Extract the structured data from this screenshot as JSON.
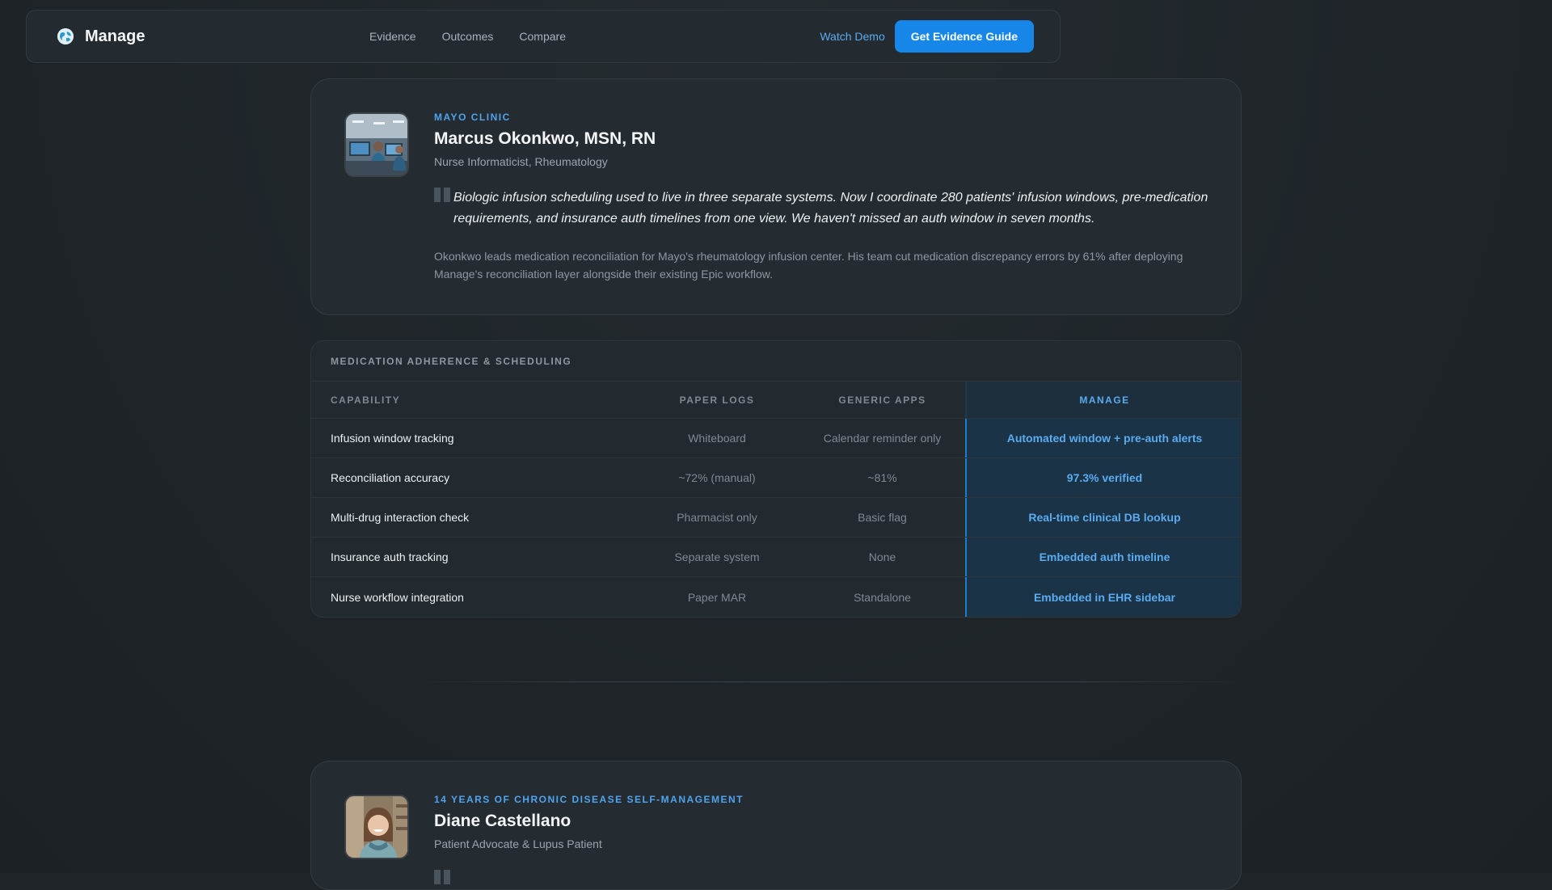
{
  "nav": {
    "brand": "Manage",
    "logo_icon": "globe-icon",
    "links": [
      "Evidence",
      "Outcomes",
      "Compare"
    ],
    "watch_demo": "Watch Demo",
    "cta": "Get Evidence Guide"
  },
  "testimonial_1": {
    "org": "MAYO CLINIC",
    "name": "Marcus Okonkwo, MSN, RN",
    "role": "Nurse Informaticist, Rheumatology",
    "quote": "Biologic infusion scheduling used to live in three separate systems. Now I coordinate 280 patients' infusion windows, pre-medication requirements, and insurance auth timelines from one view. We haven't missed an auth window in seven months.",
    "summary": "Okonkwo leads medication reconciliation for Mayo's rheumatology infusion center. His team cut medication discrepancy errors by 61% after deploying Manage's reconciliation layer alongside their existing Epic workflow."
  },
  "comparison": {
    "title": "MEDICATION ADHERENCE & SCHEDULING",
    "headers": [
      "CAPABILITY",
      "PAPER LOGS",
      "GENERIC APPS",
      "MANAGE"
    ],
    "rows": [
      [
        "Infusion window tracking",
        "Whiteboard",
        "Calendar reminder only",
        "Automated window + pre-auth alerts"
      ],
      [
        "Reconciliation accuracy",
        "~72% (manual)",
        "~81%",
        "97.3% verified"
      ],
      [
        "Multi-drug interaction check",
        "Pharmacist only",
        "Basic flag",
        "Real-time clinical DB lookup"
      ],
      [
        "Insurance auth tracking",
        "Separate system",
        "None",
        "Embedded auth timeline"
      ],
      [
        "Nurse workflow integration",
        "Paper MAR",
        "Standalone",
        "Embedded in EHR sidebar"
      ]
    ]
  },
  "testimonial_2": {
    "org": "14 YEARS OF CHRONIC DISEASE SELF-MANAGEMENT",
    "name": "Diane Castellano",
    "role": "Patient Advocate & Lupus Patient"
  },
  "colors": {
    "accent": "#1687e8",
    "link": "#5aabf0",
    "background": "#1e2428"
  }
}
